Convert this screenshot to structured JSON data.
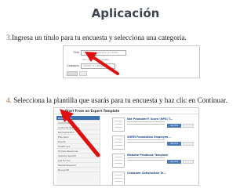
{
  "title": "Aplicación",
  "step3": {
    "num": "3.",
    "text": "Ingresa un título para tu encuesta y selecciona una categoría."
  },
  "step4": {
    "num": "4.",
    "text": " Selecciona la plantilla que usarás para tu encuesta y haz clic en Continuar."
  },
  "form": {
    "title_label": "Title",
    "title_placeholder": "Give your survey a name...",
    "hint": "You can change it later",
    "category_label": "Category",
    "category_value": "Select a category..."
  },
  "template_panel": {
    "header": "Start From an Expert Template",
    "categories": [
      {
        "label": "Most Popular",
        "count": "",
        "selected": true
      },
      {
        "label": "Community",
        "count": ""
      },
      {
        "label": "Customer Feedback",
        "count": ""
      },
      {
        "label": "Demographics",
        "count": ""
      },
      {
        "label": "Education",
        "count": ""
      },
      {
        "label": "Events",
        "count": ""
      },
      {
        "label": "Healthcare",
        "count": ""
      },
      {
        "label": "Human Resources",
        "count": ""
      },
      {
        "label": "Industry Specific",
        "count": ""
      },
      {
        "label": "Just for Fun",
        "count": ""
      },
      {
        "label": "Market Research",
        "count": ""
      },
      {
        "label": "Non-profit",
        "count": ""
      }
    ],
    "templates": [
      {
        "name": "Net Promoter® Score (NPS) T...",
        "button": "Use this template"
      },
      {
        "name": "SHRM Foundation Employee...",
        "button": "Use this template"
      },
      {
        "name": "Website Feedback Template",
        "button": "Use this template"
      },
      {
        "name": "Customer Satisfaction Te...",
        "button": ""
      }
    ]
  },
  "colors": {
    "title": "#3f4651",
    "step3_num": "#3a6f9f",
    "step4_num": "#c55a11",
    "arrow": "#e01010"
  }
}
